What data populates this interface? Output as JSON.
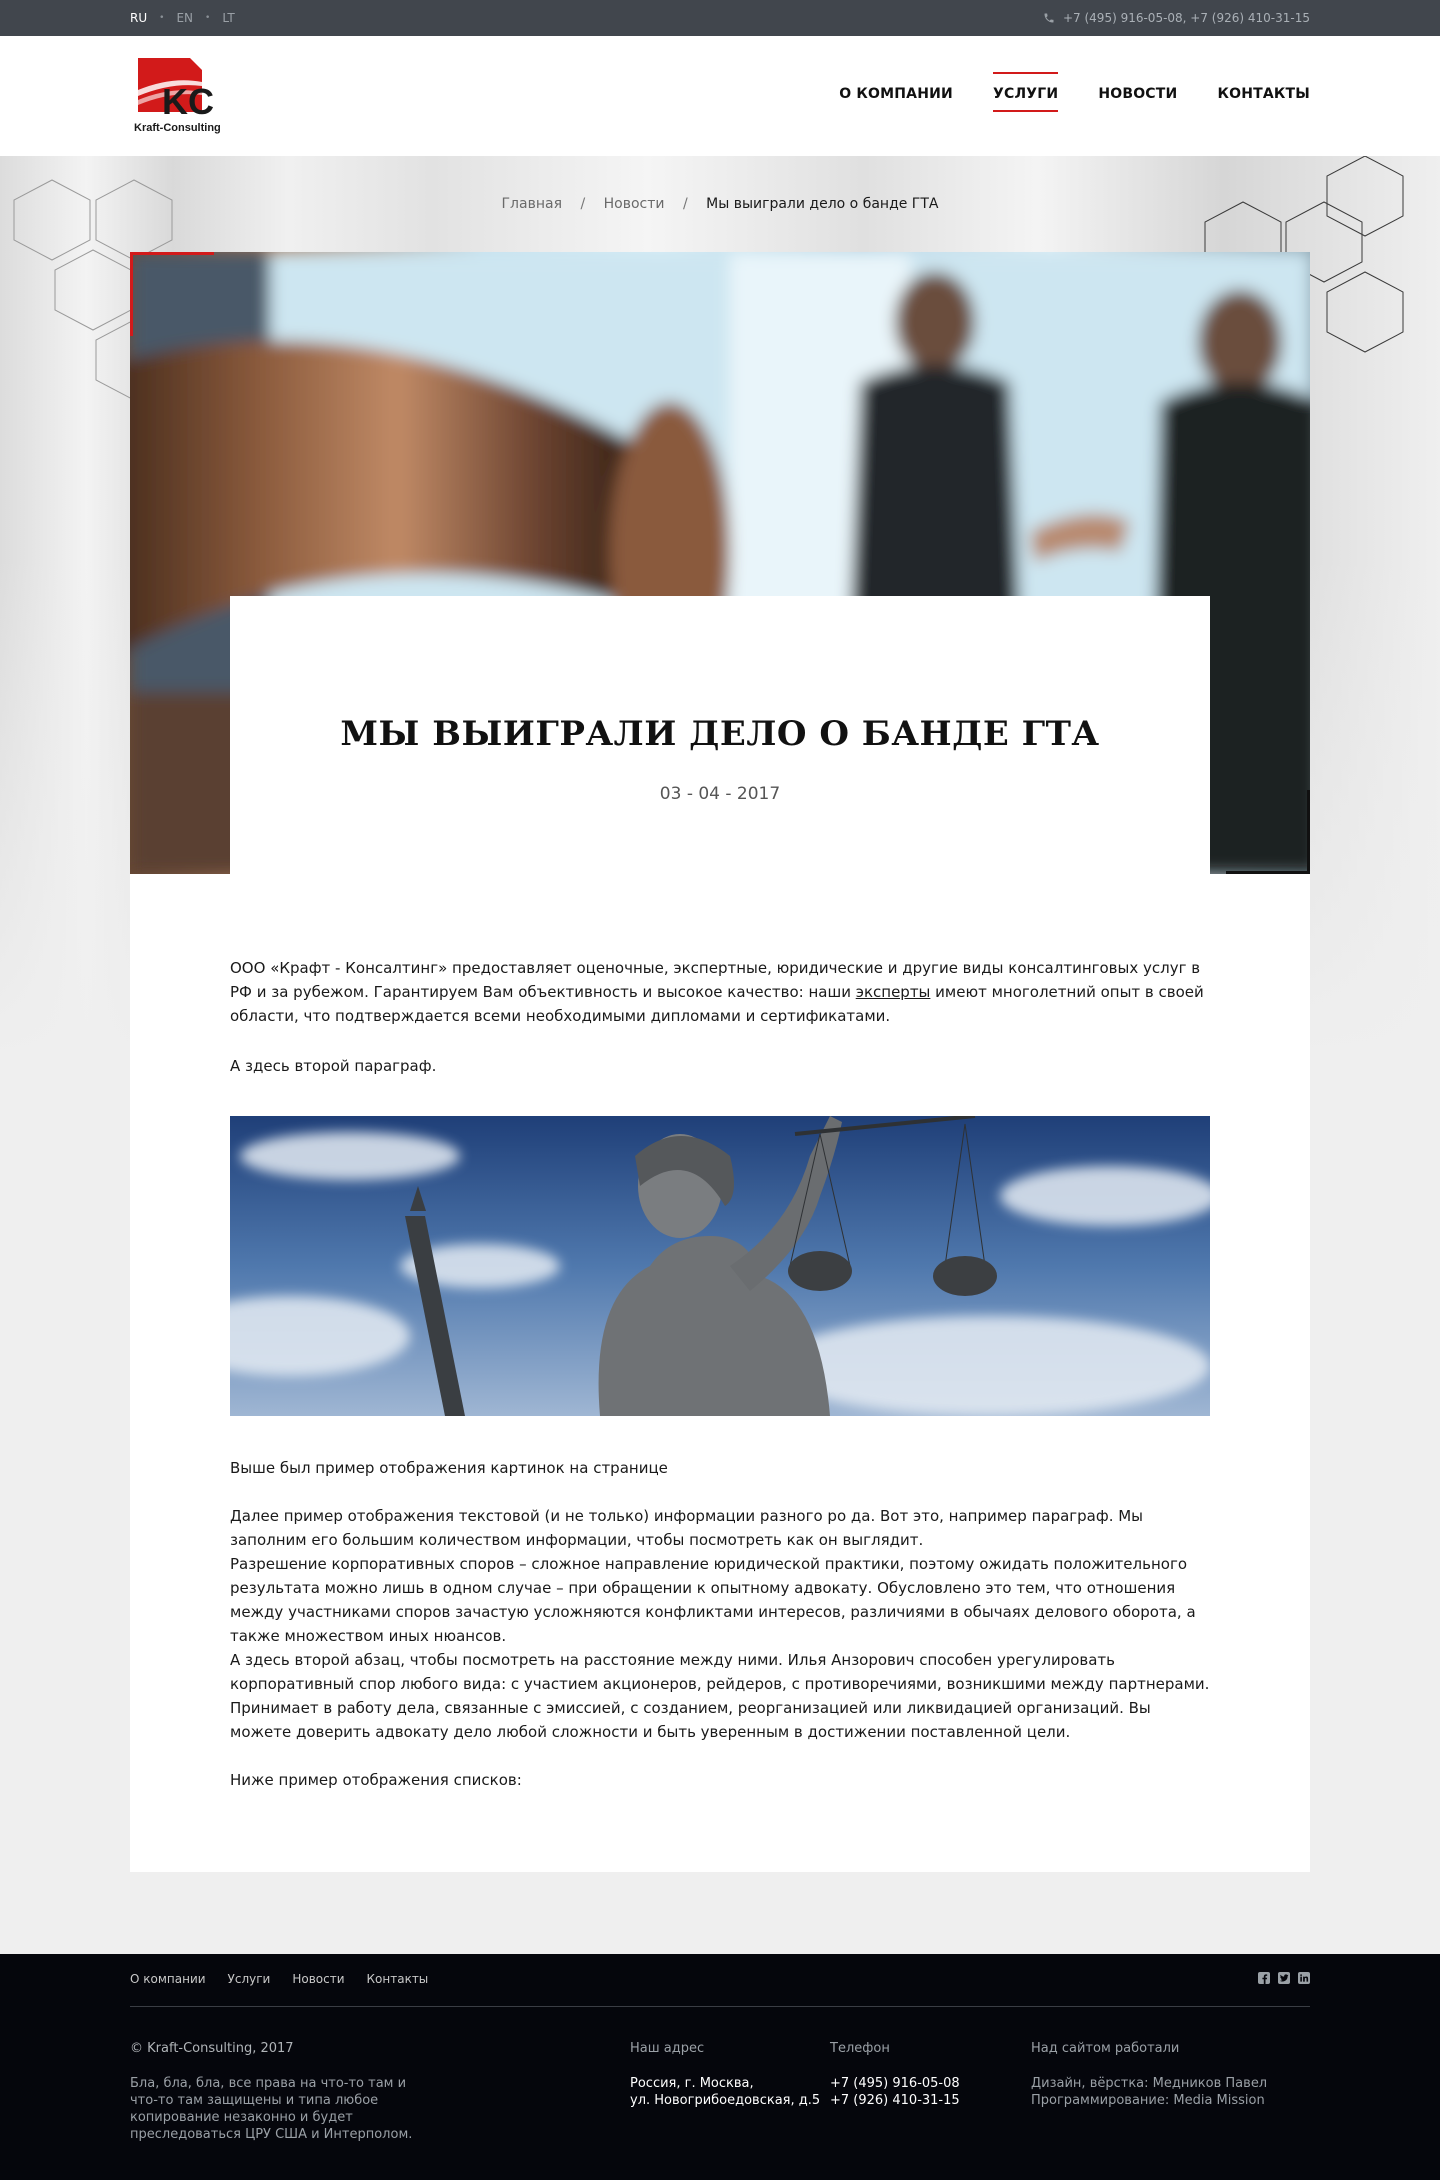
{
  "topbar": {
    "languages": [
      "RU",
      "EN",
      "LT"
    ],
    "active_language": "RU",
    "phones": "+7 (495) 916-05-08, +7 (926) 410-31-15"
  },
  "header": {
    "logo_text": "Kraft-Consulting",
    "logo_mark": "KC",
    "nav": [
      "О КОМПАНИИ",
      "УСЛУГИ",
      "НОВОСТИ",
      "КОНТАКТЫ"
    ],
    "active_nav": "УСЛУГИ"
  },
  "breadcrumb": {
    "items": [
      "Главная",
      "Новости"
    ],
    "current": "Мы выиграли дело о банде ГТА"
  },
  "article": {
    "title": "МЫ ВЫИГРАЛИ ДЕЛО О БАНДЕ ГТА",
    "date": "03 - 04 - 2017",
    "p1_before_link": "ООО «Крафт - Консалтинг» предоставляет оценочные, экспертные, юридические и другие виды консалтинговых услуг в РФ и за рубежом. Гарантируем Вам объективность и высокое качество: наши ",
    "p1_link": "эксперты",
    "p1_after_link": " имеют многолетний опыт в своей области, что подтверждается всеми необходимыми дипломами и сертификатами.",
    "p2": "А здесь второй параграф.",
    "p3": "Выше был пример отображения картинок на странице",
    "p4a": "Далее пример отображения текстовой (и не только) информации разного ро да. Вот это, например параграф. Мы заполним его большим количеством информации, чтобы посмотреть как он выглядит.",
    "p4b": "Разрешение корпоративных споров – сложное направление юридической практики, поэтому ожидать положительного результата можно лишь в одном случае – при обращении к опытному адвокату. Обусловлено это тем, что отношения между участниками споров зачастую усложняются конфликтами интересов, различиями в обычаях делового оборота, а также множеством иных нюансов.",
    "p5": "А здесь второй абзац, чтобы посмотреть на расстояние между ними. Илья Анзорович способен урегулировать корпоративный спор любого вида: с участием акционеров, рейдеров, с противоречиями, возникшими между партнерами. Принимает в работу дела, связанные с эмиссией, с созданием, реорганизацией или ликвидацией организаций. Вы можете доверить адвокату дело любой сложности и быть уверенным в достижении поставленной цели.",
    "p6": "Ниже пример отображения списков:"
  },
  "footer": {
    "nav": [
      "О компании",
      "Услуги",
      "Новости",
      "Контакты"
    ],
    "socials": [
      "facebook-icon",
      "twitter-icon",
      "linkedin-icon"
    ],
    "copyright": "© Kraft-Consulting, 2017",
    "note": "Бла, бла, бла, все права на что-то там и что-то там защищены и типа любое копирование незаконно и будет преследоваться ЦРУ США и Интерполом.",
    "address_label": "Наш адрес",
    "address_line1": "Россия, г. Москва,",
    "address_line2": "ул. Новогрибоедовская, д.5",
    "phone_label": "Телефон",
    "phone1": "+7 (495) 916-05-08",
    "phone2": "+7 (926) 410-31-15",
    "credits_label": "Над сайтом работали",
    "credit1": "Дизайн, вёрстка: Медников Павел",
    "credit2": "Программирование: Media Mission"
  },
  "colors": {
    "accent": "#d21a1a",
    "topbar": "#41464d",
    "footer": "#05060c"
  }
}
